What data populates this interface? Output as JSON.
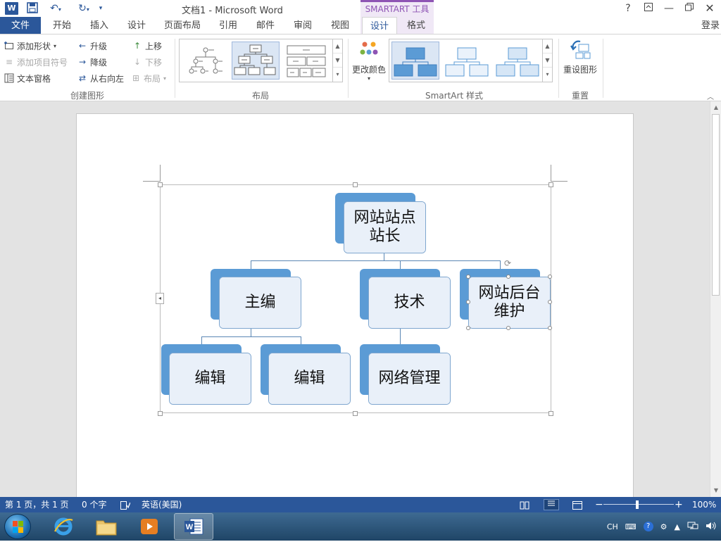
{
  "window": {
    "title": "文档1 - Microsoft Word",
    "context_tab_group": "SMARTART 工具",
    "help": "?",
    "signin": "登录"
  },
  "tabs": [
    {
      "label": "文件"
    },
    {
      "label": "开始"
    },
    {
      "label": "插入"
    },
    {
      "label": "设计"
    },
    {
      "label": "页面布局"
    },
    {
      "label": "引用"
    },
    {
      "label": "邮件"
    },
    {
      "label": "审阅"
    },
    {
      "label": "视图"
    },
    {
      "label": "设计",
      "active": true
    },
    {
      "label": "格式"
    }
  ],
  "ribbon": {
    "create_graphic": {
      "label": "创建图形",
      "add_shape": "添加形状",
      "add_bullet": "添加项目符号",
      "text_pane": "文本窗格",
      "promote": "升级",
      "demote": "降级",
      "right_to_left": "从右向左",
      "move_up": "上移",
      "move_down": "下移",
      "layout": "布局"
    },
    "layouts": {
      "label": "布局"
    },
    "change_colors": "更改颜色",
    "smartart_styles": {
      "label": "SmartArt 样式"
    },
    "reset": {
      "label": "重置",
      "reset_graphic": "重设图形"
    }
  },
  "smartart": {
    "root": "网站站点\n站长",
    "level2": [
      "主编",
      "技术",
      "网站后台\n维护"
    ],
    "level3": [
      "编辑",
      "编辑",
      "网络管理"
    ],
    "colors": {
      "accent": "#5b9bd5",
      "fill": "#e9f0f9",
      "border": "#7ea6cf"
    }
  },
  "status": {
    "page": "第 1 页，共 1 页",
    "words": "0 个字",
    "language": "英语(美国)",
    "zoom": "100%"
  },
  "taskbar": {
    "ime": "CH"
  }
}
